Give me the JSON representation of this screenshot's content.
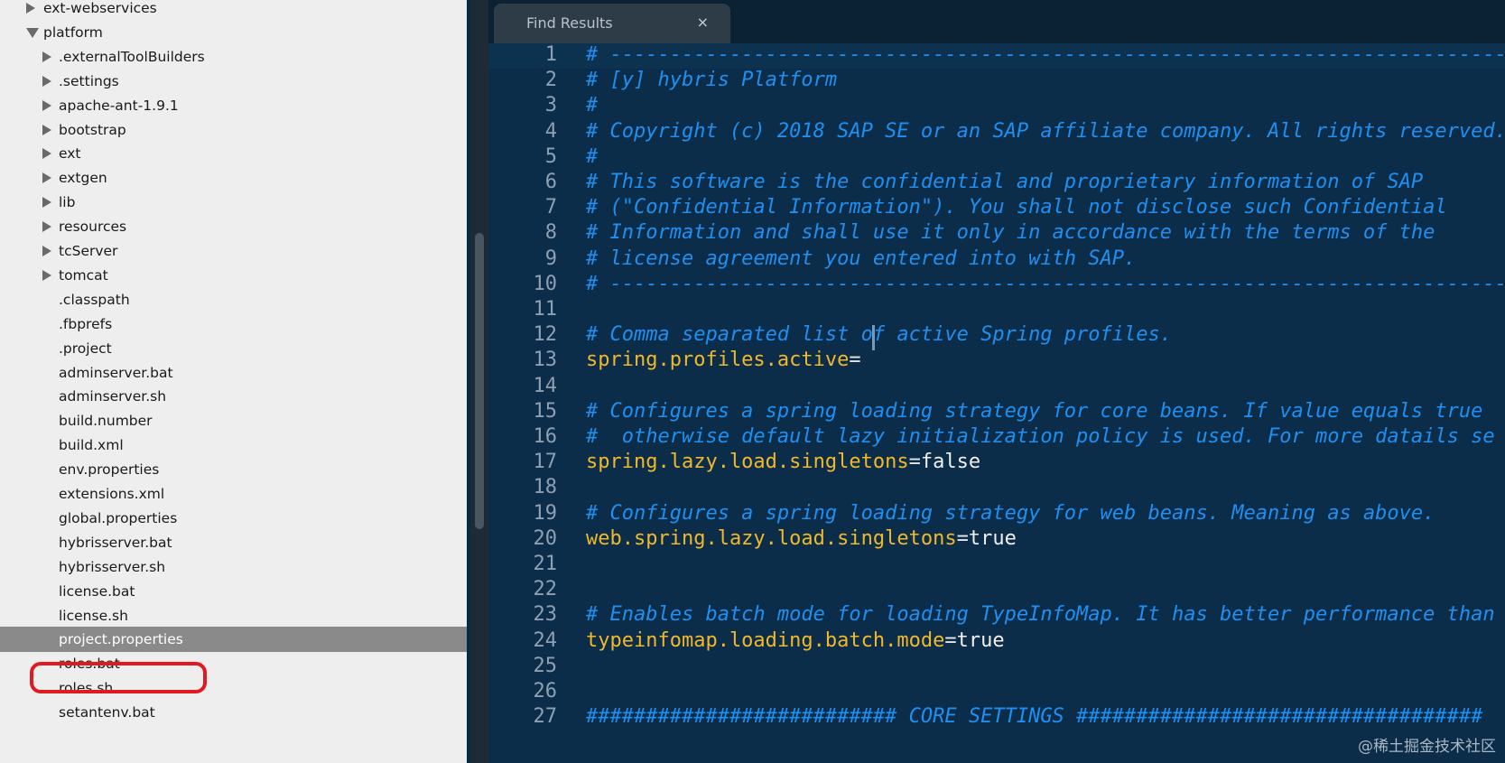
{
  "sidebar": {
    "items": [
      {
        "label": "ext-webservices",
        "type": "folder",
        "state": "collapsed",
        "depth": 0
      },
      {
        "label": "platform",
        "type": "folder",
        "state": "expanded",
        "depth": 0
      },
      {
        "label": ".externalToolBuilders",
        "type": "folder",
        "state": "collapsed",
        "depth": 1
      },
      {
        "label": ".settings",
        "type": "folder",
        "state": "collapsed",
        "depth": 1
      },
      {
        "label": "apache-ant-1.9.1",
        "type": "folder",
        "state": "collapsed",
        "depth": 1
      },
      {
        "label": "bootstrap",
        "type": "folder",
        "state": "collapsed",
        "depth": 1
      },
      {
        "label": "ext",
        "type": "folder",
        "state": "collapsed",
        "depth": 1
      },
      {
        "label": "extgen",
        "type": "folder",
        "state": "collapsed",
        "depth": 1
      },
      {
        "label": "lib",
        "type": "folder",
        "state": "collapsed",
        "depth": 1
      },
      {
        "label": "resources",
        "type": "folder",
        "state": "collapsed",
        "depth": 1
      },
      {
        "label": "tcServer",
        "type": "folder",
        "state": "collapsed",
        "depth": 1
      },
      {
        "label": "tomcat",
        "type": "folder",
        "state": "collapsed",
        "depth": 1
      },
      {
        "label": ".classpath",
        "type": "file",
        "depth": 1
      },
      {
        "label": ".fbprefs",
        "type": "file",
        "depth": 1
      },
      {
        "label": ".project",
        "type": "file",
        "depth": 1
      },
      {
        "label": "adminserver.bat",
        "type": "file",
        "depth": 1
      },
      {
        "label": "adminserver.sh",
        "type": "file",
        "depth": 1
      },
      {
        "label": "build.number",
        "type": "file",
        "depth": 1
      },
      {
        "label": "build.xml",
        "type": "file",
        "depth": 1
      },
      {
        "label": "env.properties",
        "type": "file",
        "depth": 1
      },
      {
        "label": "extensions.xml",
        "type": "file",
        "depth": 1
      },
      {
        "label": "global.properties",
        "type": "file",
        "depth": 1
      },
      {
        "label": "hybrisserver.bat",
        "type": "file",
        "depth": 1
      },
      {
        "label": "hybrisserver.sh",
        "type": "file",
        "depth": 1
      },
      {
        "label": "license.bat",
        "type": "file",
        "depth": 1
      },
      {
        "label": "license.sh",
        "type": "file",
        "depth": 1
      },
      {
        "label": "project.properties",
        "type": "file",
        "depth": 1,
        "selected": true
      },
      {
        "label": "roles.bat",
        "type": "file",
        "depth": 1
      },
      {
        "label": "roles.sh",
        "type": "file",
        "depth": 1
      },
      {
        "label": "setantenv.bat",
        "type": "file",
        "depth": 1
      }
    ]
  },
  "tabs": [
    {
      "label": "Find Results",
      "close_glyph": "×"
    }
  ],
  "editor": {
    "current_line": 1,
    "lines": [
      {
        "num": "1",
        "parts": [
          {
            "t": "# ---------------------------------------------------------------------------",
            "c": "cmt"
          }
        ]
      },
      {
        "num": "2",
        "parts": [
          {
            "t": "# [y] hybris Platform",
            "c": "cmt"
          }
        ]
      },
      {
        "num": "3",
        "parts": [
          {
            "t": "#",
            "c": "cmt"
          }
        ]
      },
      {
        "num": "4",
        "parts": [
          {
            "t": "# Copyright (c) 2018 SAP SE or an SAP affiliate company. All rights reserved.",
            "c": "cmt"
          }
        ]
      },
      {
        "num": "5",
        "parts": [
          {
            "t": "#",
            "c": "cmt"
          }
        ]
      },
      {
        "num": "6",
        "parts": [
          {
            "t": "# This software is the confidential and proprietary information of SAP",
            "c": "cmt"
          }
        ]
      },
      {
        "num": "7",
        "parts": [
          {
            "t": "# (\"Confidential Information\"). You shall not disclose such Confidential",
            "c": "cmt"
          }
        ]
      },
      {
        "num": "8",
        "parts": [
          {
            "t": "# Information and shall use it only in accordance with the terms of the",
            "c": "cmt"
          }
        ]
      },
      {
        "num": "9",
        "parts": [
          {
            "t": "# license agreement you entered into with SAP.",
            "c": "cmt"
          }
        ]
      },
      {
        "num": "10",
        "parts": [
          {
            "t": "# ---------------------------------------------------------------------------",
            "c": "cmt"
          }
        ]
      },
      {
        "num": "11",
        "parts": []
      },
      {
        "num": "12",
        "parts": [
          {
            "t": "# Comma separated list of active Spring profiles.",
            "c": "cmt"
          }
        ]
      },
      {
        "num": "13",
        "parts": [
          {
            "t": "spring.profiles.active",
            "c": "key"
          },
          {
            "t": "=",
            "c": "eq"
          }
        ]
      },
      {
        "num": "14",
        "parts": []
      },
      {
        "num": "15",
        "parts": [
          {
            "t": "# Configures a spring loading strategy for core beans. If value equals true",
            "c": "cmt"
          }
        ]
      },
      {
        "num": "16",
        "parts": [
          {
            "t": "#  otherwise default lazy initialization policy is used. For more datails se",
            "c": "cmt"
          }
        ]
      },
      {
        "num": "17",
        "parts": [
          {
            "t": "spring.lazy.load.singletons",
            "c": "key"
          },
          {
            "t": "=",
            "c": "eq"
          },
          {
            "t": "false",
            "c": "val"
          }
        ]
      },
      {
        "num": "18",
        "parts": []
      },
      {
        "num": "19",
        "parts": [
          {
            "t": "# Configures a spring loading strategy for web beans. Meaning as above.",
            "c": "cmt"
          }
        ]
      },
      {
        "num": "20",
        "parts": [
          {
            "t": "web.spring.lazy.load.singletons",
            "c": "key"
          },
          {
            "t": "=",
            "c": "eq"
          },
          {
            "t": "true",
            "c": "val"
          }
        ]
      },
      {
        "num": "21",
        "parts": []
      },
      {
        "num": "22",
        "parts": []
      },
      {
        "num": "23",
        "parts": [
          {
            "t": "# Enables batch mode for loading TypeInfoMap. It has better performance than",
            "c": "cmt"
          }
        ]
      },
      {
        "num": "24",
        "parts": [
          {
            "t": "typeinfomap.loading.batch.mode",
            "c": "key"
          },
          {
            "t": "=",
            "c": "eq"
          },
          {
            "t": "true",
            "c": "val"
          }
        ]
      },
      {
        "num": "25",
        "parts": []
      },
      {
        "num": "26",
        "parts": []
      },
      {
        "num": "27",
        "parts": [
          {
            "t": "########################## CORE SETTINGS ##################################",
            "c": "cmt"
          }
        ]
      }
    ]
  },
  "watermark": "@稀土掘金技术社区",
  "colors": {
    "comment": "#1f8ff0",
    "key": "#f0b82a",
    "value": "#f0f0f0",
    "editor_bg": "#0b2d4a",
    "sidebar_bg": "#eeeeee",
    "selected_bg": "#8a8a8a",
    "callout": "#e11a22"
  }
}
